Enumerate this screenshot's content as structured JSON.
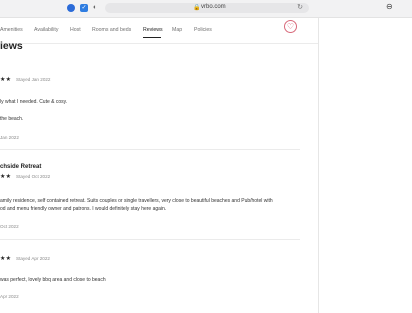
{
  "browser": {
    "url": "vrbo.com"
  },
  "nav": {
    "tabs": [
      "Amenities",
      "Availability",
      "Host",
      "Rooms and beds",
      "Reviews",
      "Map",
      "Policies"
    ],
    "active": "Reviews"
  },
  "section": {
    "title": "iews"
  },
  "reviews": [
    {
      "title": "",
      "stars": "★★",
      "stayed": "Stayed Jan 2022",
      "lines": [
        "ly what I needed. Cute & cosy.",
        "the beach."
      ],
      "date": "Jan 2022"
    },
    {
      "title": "chside Retreat",
      "stars": "★★",
      "stayed": "Stayed Oct 2022",
      "lines": [
        "amily residence, self contained retreat. Suits couples or single travellers, very close to beautiful beaches and Pub/hotel with",
        "od and menu friendly owner and patrons. I would definitely stay here again."
      ],
      "date": "Oct 2022"
    },
    {
      "title": "",
      "stars": "★★",
      "stayed": "Stayed Apr 2022",
      "lines": [
        "was perfect, lovely bbq area and close to beach"
      ],
      "date": "Apr 2022"
    }
  ]
}
